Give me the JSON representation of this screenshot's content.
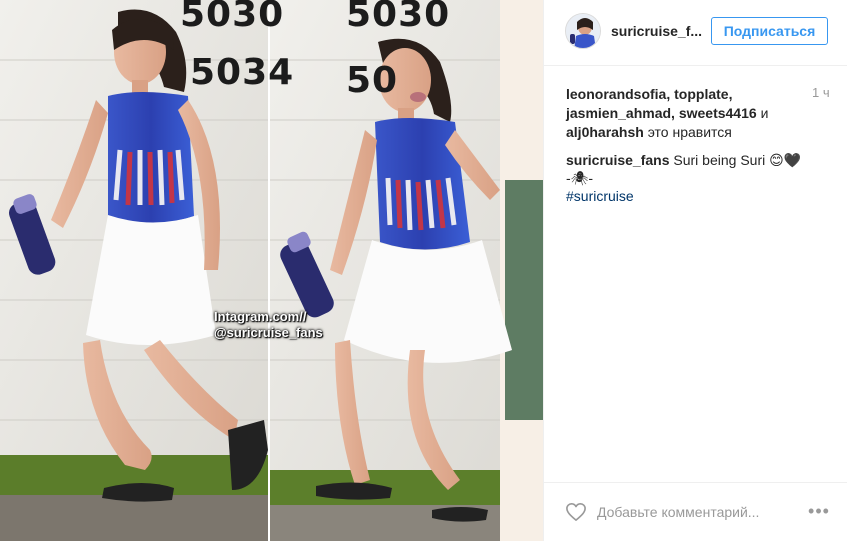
{
  "post": {
    "watermark_line1": "Intagram.com//",
    "watermark_line2": "@suricruise_fans",
    "house_numbers": [
      "5030",
      "5034",
      "5030",
      "50"
    ]
  },
  "header": {
    "username": "suricruise_f...",
    "follow_label": "Подписаться"
  },
  "likes": {
    "users": "leonorandsofia, topplate, jasmien_ahmad, sweets4416",
    "conjunction": "и",
    "last_user": "alj0harahsh",
    "suffix": "это нравится",
    "time": "1 ч"
  },
  "caption": {
    "user": "suricruise_fans",
    "text": "Suri being Suri 😊🖤",
    "line2": "-🕷-",
    "hashtag": "#suricruise"
  },
  "comment": {
    "placeholder": "Добавьте комментарий...",
    "more_glyph": "•••"
  },
  "icons": {
    "like": "heart-outline-icon",
    "more": "more-options-icon"
  },
  "colors": {
    "accent": "#3897f0",
    "hashtag": "#003569",
    "muted": "#999999"
  }
}
